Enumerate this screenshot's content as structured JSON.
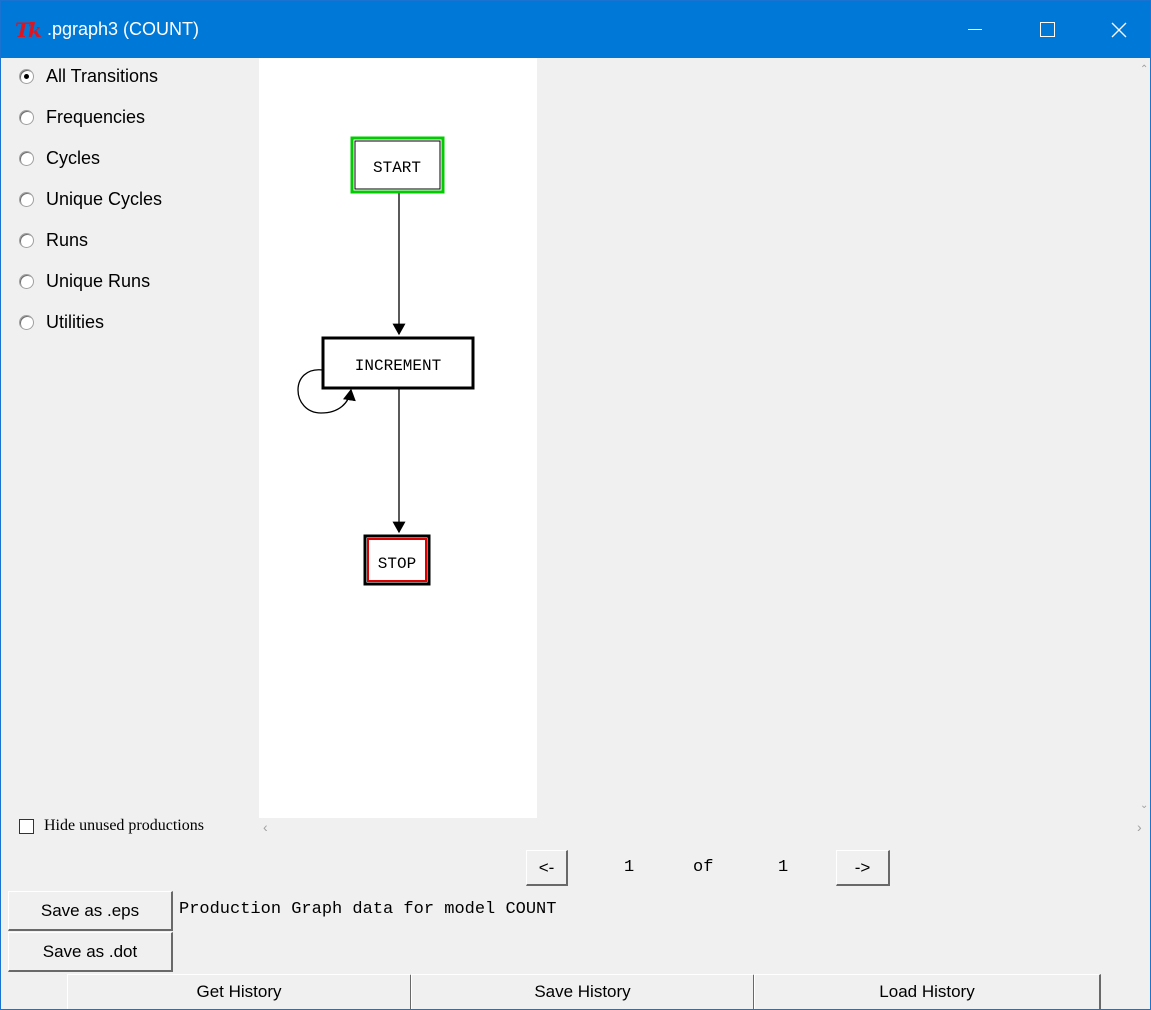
{
  "window": {
    "title": ".pgraph3 (COUNT)",
    "app_icon": "Tk",
    "colors": {
      "titlebar": "#0078d7",
      "start_border": "#00cc00",
      "stop_border": "#dd0000"
    }
  },
  "views": [
    {
      "label": "All Transitions",
      "selected": true
    },
    {
      "label": "Frequencies",
      "selected": false
    },
    {
      "label": "Cycles",
      "selected": false
    },
    {
      "label": "Unique Cycles",
      "selected": false
    },
    {
      "label": "Runs",
      "selected": false
    },
    {
      "label": "Unique Runs",
      "selected": false
    },
    {
      "label": "Utilities",
      "selected": false
    }
  ],
  "graph": {
    "nodes": [
      "START",
      "INCREMENT",
      "STOP"
    ],
    "edges": [
      [
        "START",
        "INCREMENT"
      ],
      [
        "INCREMENT",
        "INCREMENT"
      ],
      [
        "INCREMENT",
        "STOP"
      ]
    ]
  },
  "hide_unused": {
    "label": "Hide unused productions",
    "checked": false
  },
  "pager": {
    "prev_label": "<-",
    "current": "1",
    "of_label": "of",
    "total": "1",
    "next_label": "->"
  },
  "save_eps_label": "Save as .eps",
  "save_dot_label": "Save as .dot",
  "status_text": "Production Graph data for model COUNT",
  "history_buttons": {
    "get": "Get History",
    "save": "Save History",
    "load": "Load History"
  }
}
